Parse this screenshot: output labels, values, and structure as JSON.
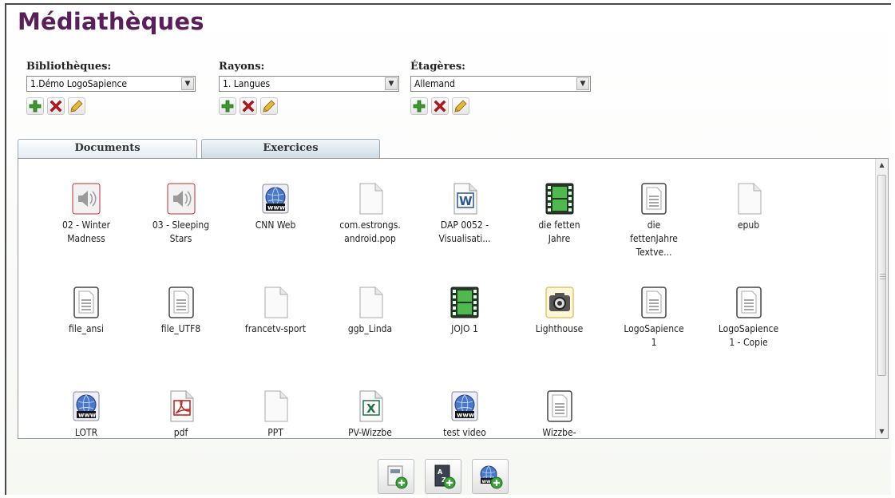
{
  "header": {
    "title": "Médiathèques"
  },
  "filters": [
    {
      "label": "Bibliothèques:",
      "value": "1.Démo LogoSapience"
    },
    {
      "label": "Rayons:",
      "value": "1. Langues"
    },
    {
      "label": "Étagères:",
      "value": "Allemand"
    }
  ],
  "tabs": [
    {
      "label": "Documents",
      "active": true
    },
    {
      "label": "Exercices",
      "active": false
    }
  ],
  "files": [
    {
      "label": "02 - Winter\nMadness",
      "icon": "audio-icon"
    },
    {
      "label": "03 - Sleeping\nStars",
      "icon": "audio-icon"
    },
    {
      "label": "CNN Web",
      "icon": "web-icon"
    },
    {
      "label": "com.estrongs.\nandroid.pop",
      "icon": "file-icon"
    },
    {
      "label": "DAP 0052 -\nVisualisati...",
      "icon": "word-icon"
    },
    {
      "label": "die fetten\nJahre",
      "icon": "video-icon"
    },
    {
      "label": "die\nfettenJahre\nTextve...",
      "icon": "text-doc-icon"
    },
    {
      "label": "epub",
      "icon": "file-icon"
    },
    {
      "label": "file_ansi",
      "icon": "text-doc-icon"
    },
    {
      "label": "file_UTF8",
      "icon": "text-doc-icon"
    },
    {
      "label": "francetv-sport",
      "icon": "file-icon"
    },
    {
      "label": "ggb_Linda",
      "icon": "file-icon"
    },
    {
      "label": "JOJO 1",
      "icon": "video-icon"
    },
    {
      "label": "Lighthouse",
      "icon": "camera-icon"
    },
    {
      "label": "LogoSapience\n1",
      "icon": "text-doc-icon"
    },
    {
      "label": "LogoSapience\n1 - Copie",
      "icon": "text-doc-icon"
    },
    {
      "label": "LOTR",
      "icon": "web-icon"
    },
    {
      "label": "pdf",
      "icon": "pdf-icon"
    },
    {
      "label": "PPT",
      "icon": "file-icon"
    },
    {
      "label": "PV-Wizzbe",
      "icon": "excel-icon"
    },
    {
      "label": "test video",
      "icon": "web-icon"
    },
    {
      "label": "Wizzbe-",
      "icon": "text-doc-icon"
    }
  ],
  "bottom_toolbar": [
    "add-document-icon",
    "add-dictionary-icon",
    "add-web-link-icon"
  ],
  "colors": {
    "title": "#5a1f5a",
    "add": "#3a9a2a",
    "delete": "#c0141e",
    "edit": "#d8a020"
  }
}
